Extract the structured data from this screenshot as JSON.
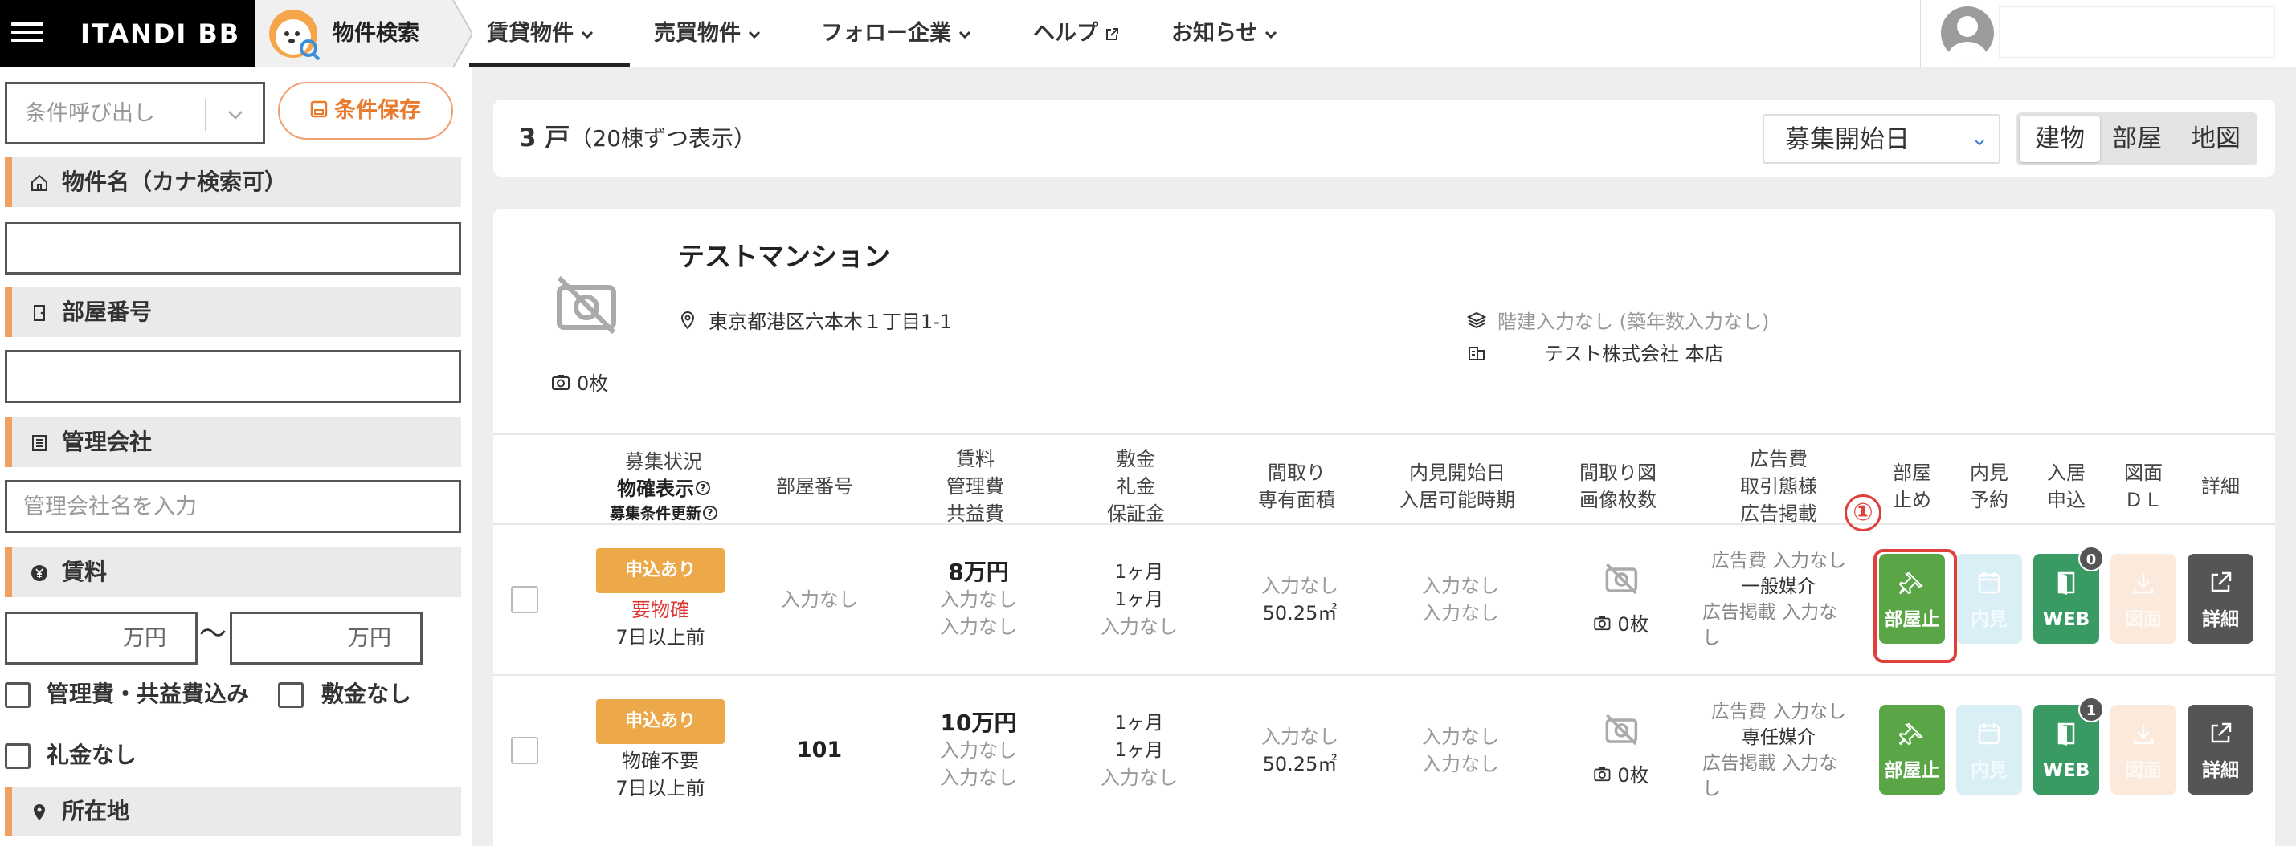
{
  "header": {
    "logo": "ITANDI BB",
    "section_title": "物件検索",
    "nav": [
      {
        "label": "賃貸物件"
      },
      {
        "label": "売買物件"
      },
      {
        "label": "フォロー企業"
      },
      {
        "label": "ヘルプ"
      },
      {
        "label": "お知らせ"
      }
    ],
    "active_nav": "賃貸物件"
  },
  "sidebar": {
    "conditions_placeholder": "条件呼び出し",
    "save_label": "条件保存",
    "sections": {
      "property_name": "物件名（カナ検索可）",
      "room_number": "部屋番号",
      "management_company": "管理会社",
      "management_company_placeholder": "管理会社名を入力",
      "rent": "賃料",
      "rent_unit_from": "万円",
      "rent_separator": "〜",
      "rent_unit_to": "万円",
      "location": "所在地"
    },
    "checkboxes": {
      "fees_included": "管理費・共益費込み",
      "no_deposit": "敷金なし",
      "no_key_money": "礼金なし"
    }
  },
  "results": {
    "count_number": "3 戸",
    "count_suffix": "（20棟ずつ表示）",
    "sort_selected": "募集開始日",
    "view_toggle": [
      "建物",
      "部屋",
      "地図"
    ],
    "active_view": "建物"
  },
  "building": {
    "name": "テストマンション",
    "address": "東京都港区六本木１丁目1-1",
    "floors": "階建入力なし (築年数入力なし)",
    "company": "テスト株式会社 本店",
    "photo_count": "0枚"
  },
  "table": {
    "headers": {
      "status": [
        "募集状況",
        "物確表示",
        "募集条件更新"
      ],
      "room_number": "部屋番号",
      "rent": [
        "賃料",
        "管理費",
        "共益費"
      ],
      "deposit": [
        "敷金",
        "礼金",
        "保証金"
      ],
      "layout": [
        "間取り",
        "専有面積"
      ],
      "viewing": [
        "内見開始日",
        "入居可能時期"
      ],
      "floorplan": [
        "間取り図",
        "画像枚数"
      ],
      "ad": [
        "広告費",
        "取引態様",
        "広告掲載"
      ],
      "hold": [
        "部屋",
        "止め"
      ],
      "reserve": [
        "内見",
        "予約"
      ],
      "apply": [
        "入居",
        "申込"
      ],
      "download": [
        "図面",
        "ＤＬ"
      ],
      "detail": "詳細"
    },
    "rows": [
      {
        "status_badge": "申込あり",
        "status_check": "要物確",
        "status_updated": "7日以上前",
        "room_number": "入力なし",
        "rent": "8万円",
        "mgmt_fee": "入力なし",
        "common_fee": "入力なし",
        "deposit": "1ヶ月",
        "key_money": "1ヶ月",
        "guarantee": "入力なし",
        "layout": "入力なし",
        "area": "50.25㎡",
        "viewing_start": "入力なし",
        "move_in": "入力なし",
        "image_count": "0枚",
        "ad_fee": "広告費 入力なし",
        "transaction": "一般媒介",
        "ad_listing": "広告掲載 入力なし",
        "apply_count": "0"
      },
      {
        "status_badge": "申込あり",
        "status_check": "物確不要",
        "status_updated": "7日以上前",
        "room_number": "101",
        "rent": "10万円",
        "mgmt_fee": "入力なし",
        "common_fee": "入力なし",
        "deposit": "1ヶ月",
        "key_money": "1ヶ月",
        "guarantee": "入力なし",
        "layout": "入力なし",
        "area": "50.25㎡",
        "viewing_start": "入力なし",
        "move_in": "入力なし",
        "image_count": "0枚",
        "ad_fee": "広告費 入力なし",
        "transaction": "専任媒介",
        "ad_listing": "広告掲載 入力なし",
        "apply_count": "1"
      }
    ],
    "actions": {
      "hold": "部屋止",
      "reserve": "内見",
      "web": "WEB",
      "download": "図面",
      "detail": "詳細"
    }
  },
  "annotation": {
    "marker": "①"
  },
  "colors": {
    "accent_orange": "#f0a060",
    "status_badge": "#eda84a",
    "hold_button": "#5aa646",
    "web_button": "#3a9a63",
    "detail_button": "#555555",
    "highlight": "#e0403a"
  }
}
